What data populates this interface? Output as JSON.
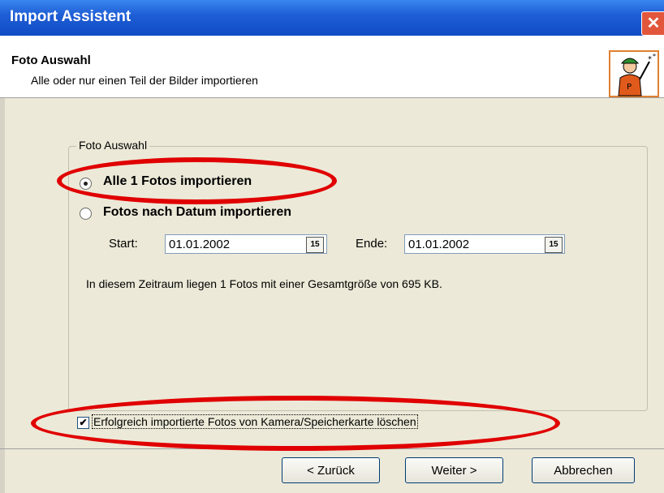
{
  "window": {
    "title": "Import Assistent",
    "close_glyph": "✕"
  },
  "header": {
    "title": "Foto Auswahl",
    "subtitle": "Alle oder nur einen Teil der Bilder importieren",
    "icon": "wizard-photographer-icon"
  },
  "group": {
    "legend": "Foto Auswahl",
    "option_all": {
      "label": "Alle 1 Fotos importieren",
      "selected": true
    },
    "option_date": {
      "label": "Fotos nach Datum importieren",
      "selected": false
    },
    "start": {
      "label": "Start:",
      "value": "01.01.2002",
      "calendar_glyph": "15"
    },
    "end": {
      "label": "Ende:",
      "value": "01.01.2002",
      "calendar_glyph": "15"
    },
    "info": "In diesem Zeitraum liegen 1 Fotos mit einer Gesamtgröße von 695 KB."
  },
  "delete_checkbox": {
    "label": "Erfolgreich importierte Fotos von Kamera/Speicherkarte löschen",
    "checked": true,
    "mark": "✔"
  },
  "buttons": {
    "back": "< Zurück",
    "next": "Weiter >",
    "cancel": "Abbrechen"
  },
  "colors": {
    "titlebar": "#1f5fd6",
    "dialog_bg": "#ece9d8",
    "highlight_ellipse": "#e00000"
  }
}
